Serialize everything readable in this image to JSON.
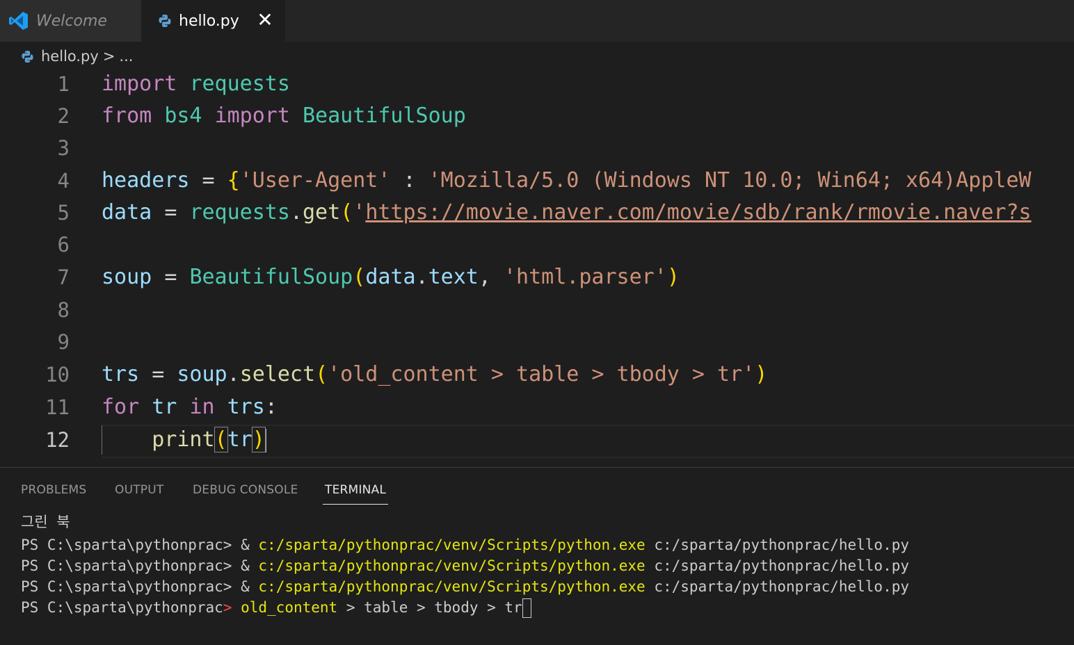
{
  "tabs": [
    {
      "label": "Welcome",
      "active": false
    },
    {
      "label": "hello.py",
      "active": true
    }
  ],
  "breadcrumb": {
    "file": "hello.py",
    "separator": ">",
    "more": "..."
  },
  "editor": {
    "line_numbers": [
      "1",
      "2",
      "3",
      "4",
      "5",
      "6",
      "7",
      "8",
      "9",
      "10",
      "11",
      "12"
    ],
    "active_line": "12",
    "tokens": {
      "l1": [
        "import",
        "requests"
      ],
      "l2": [
        "from",
        "bs4",
        "import",
        "BeautifulSoup"
      ],
      "l4": [
        "headers",
        "=",
        "{",
        "'User-Agent'",
        ":",
        "'Mozilla/5.0 (Windows NT 10.0; Win64; x64)AppleW"
      ],
      "l5": [
        "data",
        "=",
        "requests",
        ".",
        "get",
        "(",
        "'",
        "https://movie.naver.com/movie/sdb/rank/rmovie.naver?s"
      ],
      "l7": [
        "soup",
        "=",
        "BeautifulSoup",
        "(",
        "data",
        ".",
        "text",
        ",",
        "'html.parser'",
        ")"
      ],
      "l10": [
        "trs",
        "=",
        "soup",
        ".",
        "select",
        "(",
        "'old_content > table > tbody > tr'",
        ")"
      ],
      "l11": [
        "for",
        "tr",
        "in",
        "trs",
        ":"
      ],
      "l12": [
        "print",
        "(",
        "tr",
        ")"
      ]
    }
  },
  "panel": {
    "tabs": [
      "PROBLEMS",
      "OUTPUT",
      "DEBUG CONSOLE",
      "TERMINAL"
    ],
    "active_tab": "TERMINAL"
  },
  "terminal": {
    "first_line": "그린 북",
    "prompt": "PS C:\\sparta\\pythonprac>",
    "commands": [
      {
        "amp": "&",
        "exe": "c:/sparta/pythonprac/venv/Scripts/python.exe",
        "script": "c:/sparta/pythonprac/hello.py"
      },
      {
        "amp": "&",
        "exe": "c:/sparta/pythonprac/venv/Scripts/python.exe",
        "script": "c:/sparta/pythonprac/hello.py"
      },
      {
        "amp": "&",
        "exe": "c:/sparta/pythonprac/venv/Scripts/python.exe",
        "script": "c:/sparta/pythonprac/hello.py"
      }
    ],
    "last_prompt": "PS C:\\sparta\\pythonprac",
    "last_arrow": ">",
    "last_cmd": "old_content",
    "last_args": " > table > tbody > tr"
  },
  "colors": {
    "background": "#1e1e1e",
    "keyword": "#c586c0",
    "string": "#ce9178",
    "type": "#4ec9b0",
    "variable": "#9cdcfe",
    "function": "#dcdcaa",
    "bracket": "#ffd700",
    "terminal_yellow": "#e5e510"
  },
  "icons": [
    "vscode-logo-icon",
    "python-file-icon",
    "close-icon",
    "chevron-right-icon"
  ]
}
